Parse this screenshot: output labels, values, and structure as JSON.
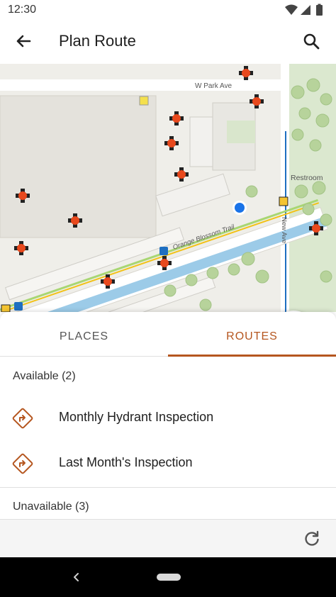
{
  "status_bar": {
    "time": "12:30",
    "icons": [
      "wifi-icon",
      "cell-signal-icon",
      "battery-icon"
    ]
  },
  "app_bar": {
    "title": "Plan Route",
    "back_icon": "arrow-back-icon",
    "search_icon": "search-icon"
  },
  "map": {
    "street_labels": [
      "W Park Ave",
      "Orange Blossom Trail",
      "New Ave"
    ],
    "poi_labels": [
      "Restroom"
    ],
    "locate_icon": "gps-fixed-icon"
  },
  "tabs": [
    {
      "label": "PLACES",
      "selected": false
    },
    {
      "label": "ROUTES",
      "selected": true
    }
  ],
  "sections": {
    "available": "Available (2)",
    "unavailable": "Unavailable (3)"
  },
  "routes": [
    {
      "label": "Monthly Hydrant Inspection",
      "icon": "route-diamond-icon"
    },
    {
      "label": "Last Month's Inspection",
      "icon": "route-diamond-icon"
    }
  ],
  "toolbar": {
    "refresh_icon": "refresh-icon"
  },
  "colors": {
    "accent": "#b5561f",
    "location_dot": "#1a73e8",
    "hydrant": "#e8491d"
  }
}
